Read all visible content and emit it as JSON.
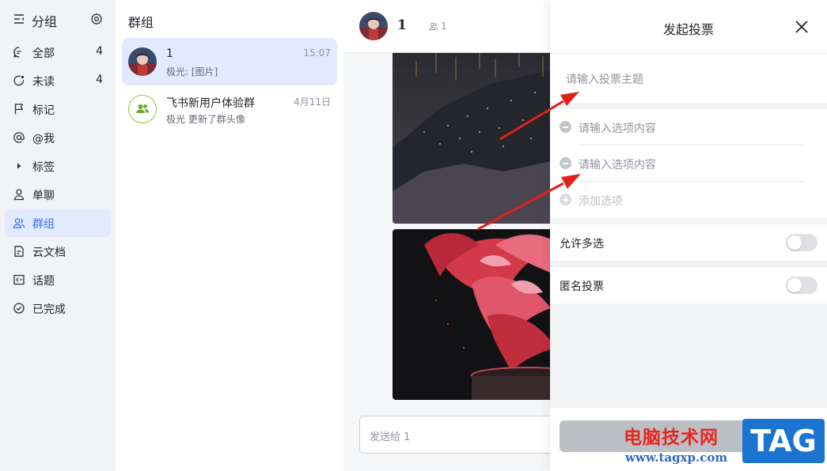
{
  "sidebar": {
    "title": "分组",
    "items": [
      {
        "label": "全部",
        "count": "4",
        "icon": "chat-bubble-icon"
      },
      {
        "label": "未读",
        "count": "4",
        "icon": "unread-circle-icon"
      },
      {
        "label": "标记",
        "count": "",
        "icon": "flag-icon"
      },
      {
        "label": "@我",
        "count": "",
        "icon": "at-icon"
      },
      {
        "label": "标签",
        "count": "",
        "icon": "caret-right-icon"
      },
      {
        "label": "单聊",
        "count": "",
        "icon": "person-icon"
      },
      {
        "label": "群组",
        "count": "",
        "icon": "group-icon"
      },
      {
        "label": "云文档",
        "count": "",
        "icon": "document-icon"
      },
      {
        "label": "话题",
        "count": "",
        "icon": "topic-icon"
      },
      {
        "label": "已完成",
        "count": "",
        "icon": "check-circle-icon"
      }
    ],
    "active_index": 6
  },
  "conversations": {
    "title": "群组",
    "items": [
      {
        "name": "1",
        "time": "15:07",
        "preview": "极光: [图片]"
      },
      {
        "name": "飞书新用户体验群",
        "time": "4月11日",
        "preview": "极光 更新了群头像"
      }
    ]
  },
  "chat": {
    "name": "1",
    "member_count": "1",
    "input_placeholder": "发送给 1"
  },
  "poll": {
    "title": "发起投票",
    "topic_placeholder": "请输入投票主题",
    "option_placeholders": [
      "请输入选项内容",
      "请输入选项内容"
    ],
    "add_option_label": "添加选项",
    "allow_multiple_label": "允许多选",
    "allow_multiple": false,
    "anonymous_label": "匿名投票",
    "anonymous": false
  },
  "watermark": {
    "text": "电脑技术网",
    "url": "www.tagxp.com",
    "tag": "TAG"
  },
  "colors": {
    "accent": "#3370ff",
    "active_bg": "#e1eaff",
    "arrow": "#e0201a",
    "watermark_red": "#e8261f",
    "watermark_blue": "#1b74cf"
  }
}
